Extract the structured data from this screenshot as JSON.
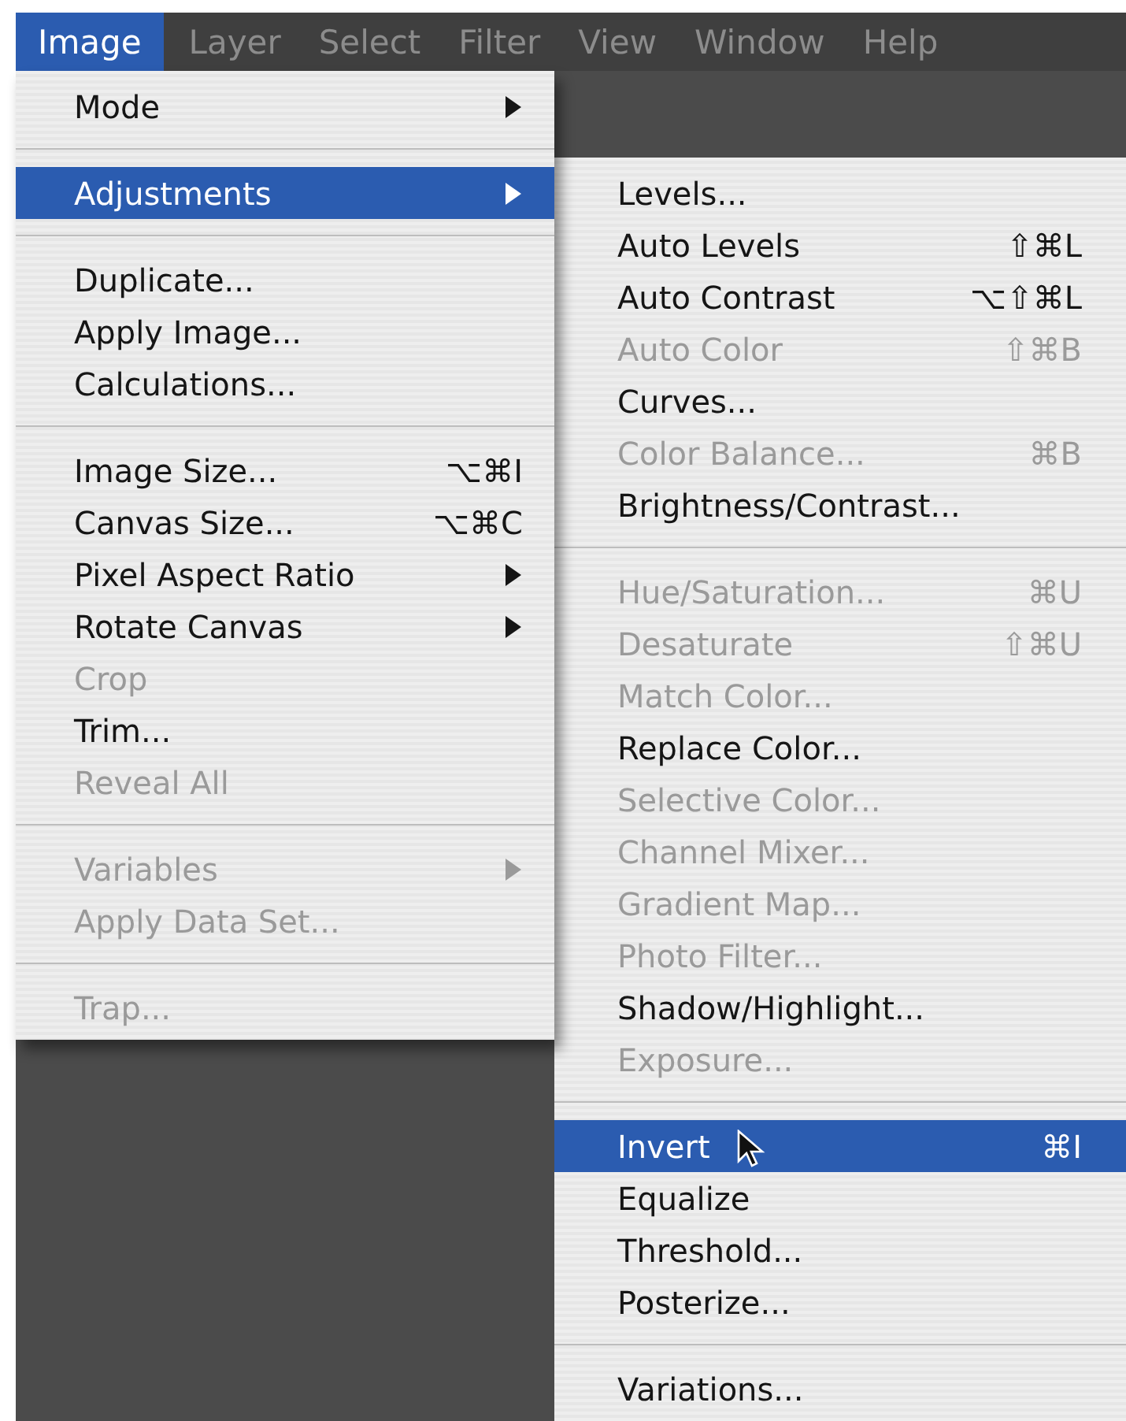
{
  "menu_bar": [
    {
      "label": "Image",
      "selected": true
    },
    {
      "label": "Layer",
      "selected": false
    },
    {
      "label": "Select",
      "selected": false
    },
    {
      "label": "Filter",
      "selected": false
    },
    {
      "label": "View",
      "selected": false
    },
    {
      "label": "Window",
      "selected": false
    },
    {
      "label": "Help",
      "selected": false
    }
  ],
  "image_menu": [
    {
      "kind": "item",
      "label": "Mode",
      "submenu": true,
      "disabled": false,
      "selected": false
    },
    {
      "kind": "separator"
    },
    {
      "kind": "item",
      "label": "Adjustments",
      "submenu": true,
      "disabled": false,
      "selected": true
    },
    {
      "kind": "separator"
    },
    {
      "kind": "item",
      "label": "Duplicate...",
      "disabled": false,
      "selected": false
    },
    {
      "kind": "item",
      "label": "Apply Image...",
      "disabled": false,
      "selected": false
    },
    {
      "kind": "item",
      "label": "Calculations...",
      "disabled": false,
      "selected": false
    },
    {
      "kind": "separator"
    },
    {
      "kind": "item",
      "label": "Image Size...",
      "shortcut": "⌥⌘I",
      "disabled": false,
      "selected": false
    },
    {
      "kind": "item",
      "label": "Canvas Size...",
      "shortcut": "⌥⌘C",
      "disabled": false,
      "selected": false
    },
    {
      "kind": "item",
      "label": "Pixel Aspect Ratio",
      "submenu": true,
      "disabled": false,
      "selected": false
    },
    {
      "kind": "item",
      "label": "Rotate Canvas",
      "submenu": true,
      "disabled": false,
      "selected": false
    },
    {
      "kind": "item",
      "label": "Crop",
      "disabled": true,
      "selected": false
    },
    {
      "kind": "item",
      "label": "Trim...",
      "disabled": false,
      "selected": false
    },
    {
      "kind": "item",
      "label": "Reveal All",
      "disabled": true,
      "selected": false
    },
    {
      "kind": "separator"
    },
    {
      "kind": "item",
      "label": "Variables",
      "submenu": true,
      "disabled": true,
      "selected": false
    },
    {
      "kind": "item",
      "label": "Apply Data Set...",
      "disabled": true,
      "selected": false
    },
    {
      "kind": "separator"
    },
    {
      "kind": "item",
      "label": "Trap...",
      "disabled": true,
      "selected": false
    }
  ],
  "adjustments_submenu": [
    {
      "kind": "item",
      "label": "Levels...",
      "disabled": false,
      "selected": false
    },
    {
      "kind": "item",
      "label": "Auto Levels",
      "shortcut": "⇧⌘L",
      "disabled": false,
      "selected": false
    },
    {
      "kind": "item",
      "label": "Auto Contrast",
      "shortcut": "⌥⇧⌘L",
      "disabled": false,
      "selected": false
    },
    {
      "kind": "item",
      "label": "Auto Color",
      "shortcut": "⇧⌘B",
      "disabled": true,
      "selected": false
    },
    {
      "kind": "item",
      "label": "Curves...",
      "disabled": false,
      "selected": false
    },
    {
      "kind": "item",
      "label": "Color Balance...",
      "shortcut": "⌘B",
      "disabled": true,
      "selected": false
    },
    {
      "kind": "item",
      "label": "Brightness/Contrast...",
      "disabled": false,
      "selected": false
    },
    {
      "kind": "separator"
    },
    {
      "kind": "item",
      "label": "Hue/Saturation...",
      "shortcut": "⌘U",
      "disabled": true,
      "selected": false
    },
    {
      "kind": "item",
      "label": "Desaturate",
      "shortcut": "⇧⌘U",
      "disabled": true,
      "selected": false
    },
    {
      "kind": "item",
      "label": "Match Color...",
      "disabled": true,
      "selected": false
    },
    {
      "kind": "item",
      "label": "Replace Color...",
      "disabled": false,
      "selected": false
    },
    {
      "kind": "item",
      "label": "Selective Color...",
      "disabled": true,
      "selected": false
    },
    {
      "kind": "item",
      "label": "Channel Mixer...",
      "disabled": true,
      "selected": false
    },
    {
      "kind": "item",
      "label": "Gradient Map...",
      "disabled": true,
      "selected": false
    },
    {
      "kind": "item",
      "label": "Photo Filter...",
      "disabled": true,
      "selected": false
    },
    {
      "kind": "item",
      "label": "Shadow/Highlight...",
      "disabled": false,
      "selected": false
    },
    {
      "kind": "item",
      "label": "Exposure...",
      "disabled": true,
      "selected": false
    },
    {
      "kind": "separator"
    },
    {
      "kind": "item",
      "label": "Invert",
      "shortcut": "⌘I",
      "disabled": false,
      "selected": true
    },
    {
      "kind": "item",
      "label": "Equalize",
      "disabled": false,
      "selected": false
    },
    {
      "kind": "item",
      "label": "Threshold...",
      "disabled": false,
      "selected": false
    },
    {
      "kind": "item",
      "label": "Posterize...",
      "disabled": false,
      "selected": false
    },
    {
      "kind": "separator"
    },
    {
      "kind": "item",
      "label": "Variations...",
      "disabled": false,
      "selected": false
    }
  ]
}
